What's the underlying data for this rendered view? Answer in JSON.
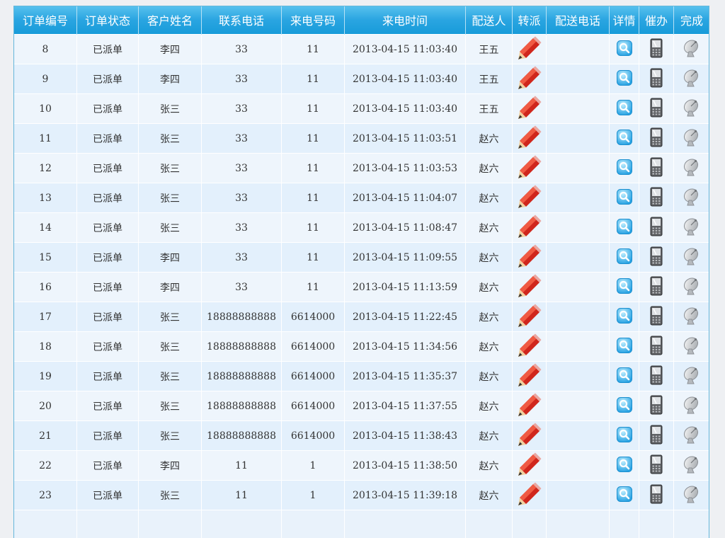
{
  "headers": [
    "订单编号",
    "订单状态",
    "客户姓名",
    "联系电话",
    "来电号码",
    "来电时间",
    "配送人",
    "转派",
    "配送电话",
    "详情",
    "催办",
    "完成"
  ],
  "rows": [
    {
      "id": "8",
      "status": "已派单",
      "customer": "李四",
      "phone": "33",
      "caller": "11",
      "time": "2013-04-15 11:03:40",
      "courier": "王五",
      "courier_phone": ""
    },
    {
      "id": "9",
      "status": "已派单",
      "customer": "李四",
      "phone": "33",
      "caller": "11",
      "time": "2013-04-15 11:03:40",
      "courier": "王五",
      "courier_phone": ""
    },
    {
      "id": "10",
      "status": "已派单",
      "customer": "张三",
      "phone": "33",
      "caller": "11",
      "time": "2013-04-15 11:03:40",
      "courier": "王五",
      "courier_phone": ""
    },
    {
      "id": "11",
      "status": "已派单",
      "customer": "张三",
      "phone": "33",
      "caller": "11",
      "time": "2013-04-15 11:03:51",
      "courier": "赵六",
      "courier_phone": ""
    },
    {
      "id": "12",
      "status": "已派单",
      "customer": "张三",
      "phone": "33",
      "caller": "11",
      "time": "2013-04-15 11:03:53",
      "courier": "赵六",
      "courier_phone": ""
    },
    {
      "id": "13",
      "status": "已派单",
      "customer": "张三",
      "phone": "33",
      "caller": "11",
      "time": "2013-04-15 11:04:07",
      "courier": "赵六",
      "courier_phone": ""
    },
    {
      "id": "14",
      "status": "已派单",
      "customer": "张三",
      "phone": "33",
      "caller": "11",
      "time": "2013-04-15 11:08:47",
      "courier": "赵六",
      "courier_phone": ""
    },
    {
      "id": "15",
      "status": "已派单",
      "customer": "李四",
      "phone": "33",
      "caller": "11",
      "time": "2013-04-15 11:09:55",
      "courier": "赵六",
      "courier_phone": ""
    },
    {
      "id": "16",
      "status": "已派单",
      "customer": "李四",
      "phone": "33",
      "caller": "11",
      "time": "2013-04-15 11:13:59",
      "courier": "赵六",
      "courier_phone": ""
    },
    {
      "id": "17",
      "status": "已派单",
      "customer": "张三",
      "phone": "18888888888",
      "caller": "6614000",
      "time": "2013-04-15 11:22:45",
      "courier": "赵六",
      "courier_phone": ""
    },
    {
      "id": "18",
      "status": "已派单",
      "customer": "张三",
      "phone": "18888888888",
      "caller": "6614000",
      "time": "2013-04-15 11:34:56",
      "courier": "赵六",
      "courier_phone": ""
    },
    {
      "id": "19",
      "status": "已派单",
      "customer": "张三",
      "phone": "18888888888",
      "caller": "6614000",
      "time": "2013-04-15 11:35:37",
      "courier": "赵六",
      "courier_phone": ""
    },
    {
      "id": "20",
      "status": "已派单",
      "customer": "张三",
      "phone": "18888888888",
      "caller": "6614000",
      "time": "2013-04-15 11:37:55",
      "courier": "赵六",
      "courier_phone": ""
    },
    {
      "id": "21",
      "status": "已派单",
      "customer": "张三",
      "phone": "18888888888",
      "caller": "6614000",
      "time": "2013-04-15 11:38:43",
      "courier": "赵六",
      "courier_phone": ""
    },
    {
      "id": "22",
      "status": "已派单",
      "customer": "李四",
      "phone": "11",
      "caller": "1",
      "time": "2013-04-15 11:38:50",
      "courier": "赵六",
      "courier_phone": ""
    },
    {
      "id": "23",
      "status": "已派单",
      "customer": "张三",
      "phone": "11",
      "caller": "1",
      "time": "2013-04-15 11:39:18",
      "courier": "赵六",
      "courier_phone": ""
    }
  ],
  "icons": {
    "reassign": "pencil-icon",
    "details": "magnifier-icon",
    "urge": "mobile-phone-icon",
    "complete": "satellite-dish-icon"
  },
  "colors": {
    "header_top": "#59c2ee",
    "header_bottom": "#179bd9",
    "row_odd": "#eef5fc",
    "row_even": "#e3f0fc",
    "frame_border": "#65b7db"
  }
}
